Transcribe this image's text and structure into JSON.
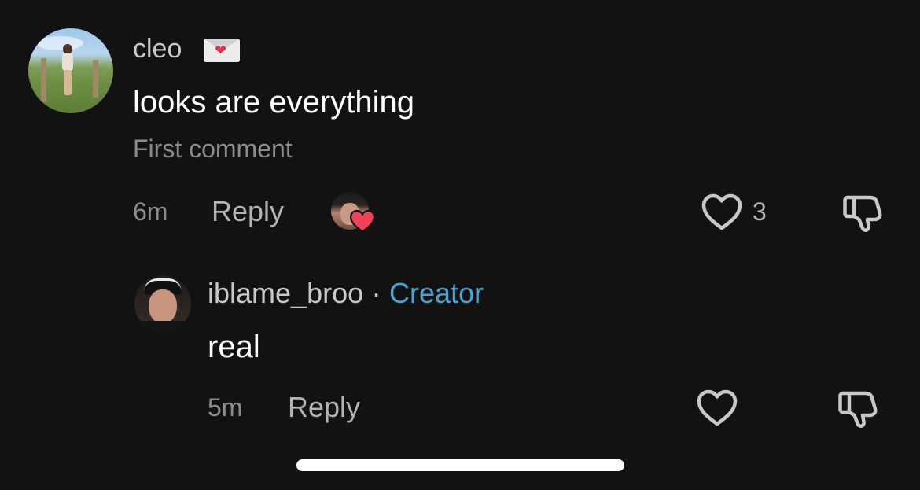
{
  "comment": {
    "username": "cleo",
    "username_emoji_icon": "love-letter-icon",
    "text": "looks are everything",
    "note": "First comment",
    "time": "6m",
    "reply_label": "Reply",
    "like_count": "3",
    "creator_liked": true,
    "creator_liked_icon": "heart-icon",
    "like_icon": "heart-outline-icon",
    "dislike_icon": "thumbs-down-icon"
  },
  "reply": {
    "username": "iblame_broo",
    "separator": "·",
    "badge": "Creator",
    "text": "real",
    "time": "5m",
    "reply_label": "Reply",
    "like_icon": "heart-outline-icon",
    "dislike_icon": "thumbs-down-icon"
  },
  "colors": {
    "background": "#121212",
    "creator_badge": "#46a3d6",
    "liked_heart": "#f0415b",
    "muted_text": "#8c8c8c"
  }
}
